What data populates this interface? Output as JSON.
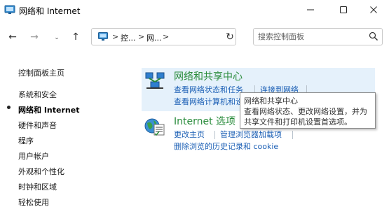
{
  "window": {
    "title": "网络和 Internet",
    "controls": {
      "minimize": "—",
      "maximize": "☐",
      "close": "✕"
    }
  },
  "nav": {
    "back": "←",
    "forward": "→",
    "recent": "⌄",
    "up": "↑",
    "breadcrumbs": [
      "控...",
      "网..."
    ],
    "separators": [
      ">",
      ">",
      ">"
    ],
    "address_dropdown": "⌄",
    "refresh": "↻",
    "search": {
      "value": "",
      "placeholder": "搜索控制面板"
    }
  },
  "sidebar": {
    "home": "控制面板主页",
    "items": [
      {
        "label": "系统和安全"
      },
      {
        "label": "网络和 Internet",
        "current": true
      },
      {
        "label": "硬件和声音"
      },
      {
        "label": "程序"
      },
      {
        "label": "用户帐户"
      },
      {
        "label": "外观和个性化"
      },
      {
        "label": "时钟和区域"
      },
      {
        "label": "轻松使用"
      }
    ]
  },
  "sections": [
    {
      "title": "网络和共享中心",
      "icon": "network-sharing-icon",
      "links": [
        "查看网络状态和任务",
        "连接到网络",
        "查看网络计算机和设"
      ]
    },
    {
      "title": "Internet 选项",
      "icon": "internet-options-icon",
      "links": [
        "更改主页",
        "管理浏览器加载项",
        "删除浏览的历史记录和 cookie"
      ]
    }
  ],
  "tooltip": {
    "lines": [
      "网络和共享中心",
      "查看网络状态、更改网络设置，并为",
      "共享文件和打印机设置首选项。"
    ]
  },
  "colors": {
    "link": "#1b5fb5",
    "section_title": "#2a8c3c",
    "hover_highlight": "#e5f1fb"
  }
}
